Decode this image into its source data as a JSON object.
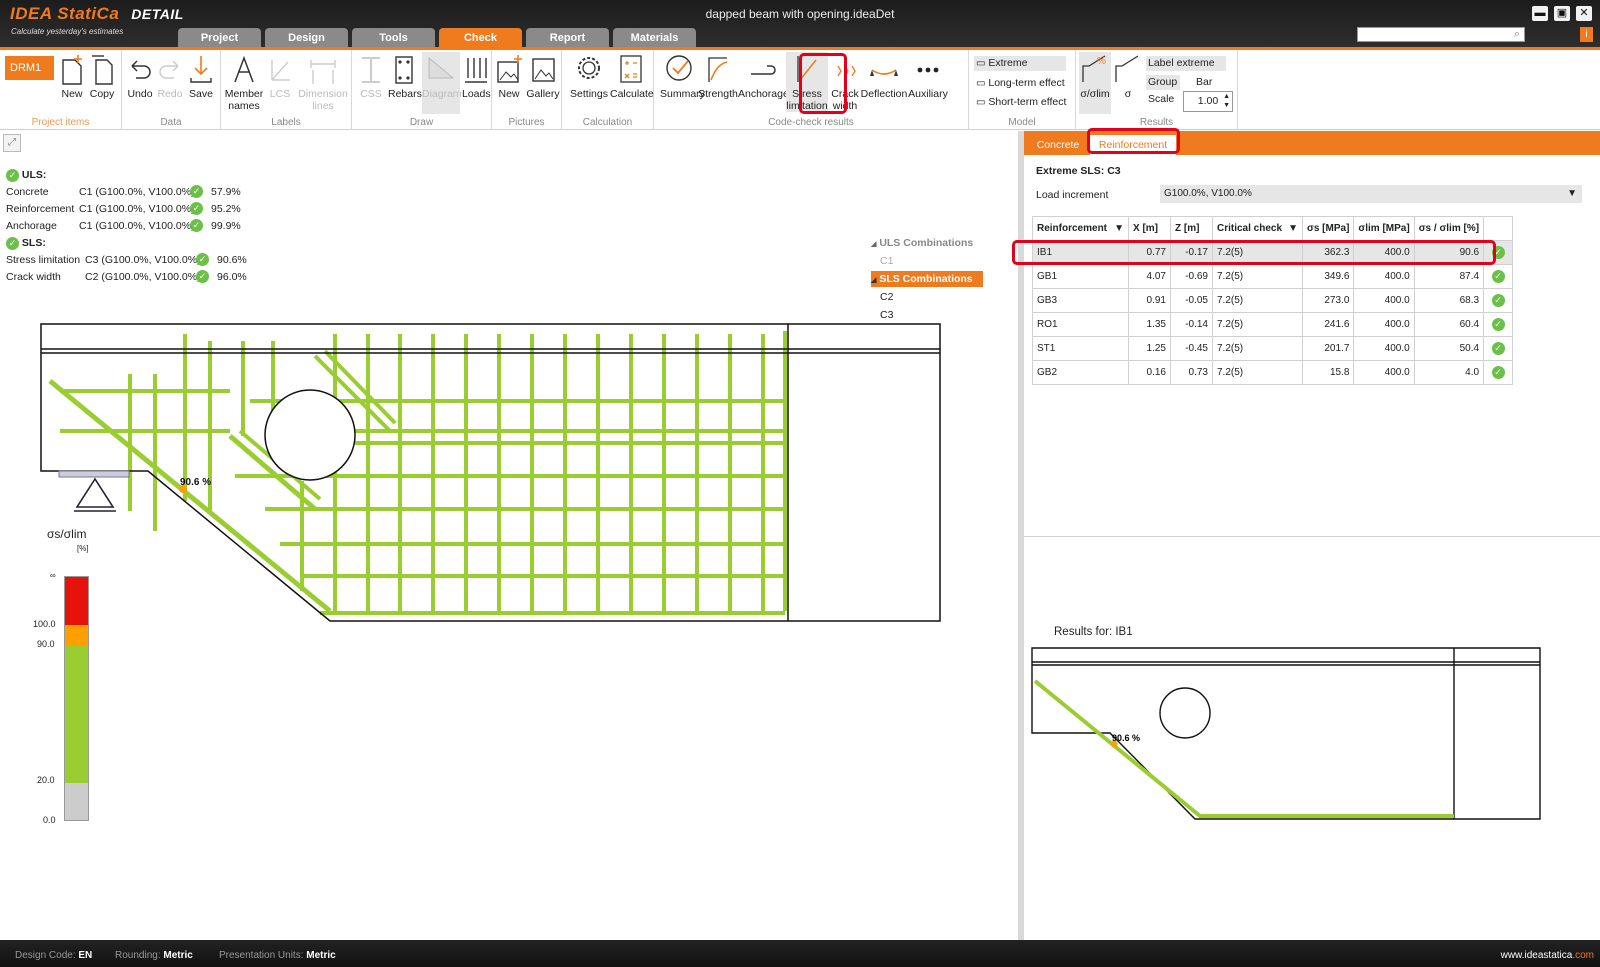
{
  "app": {
    "brand": "IDEA StatiCa",
    "product": "DETAIL",
    "slogan": "Calculate yesterday's estimates",
    "title": "dapped beam with opening.ideaDet"
  },
  "tabs": [
    "Project",
    "Design",
    "Tools",
    "Check",
    "Report",
    "Materials"
  ],
  "active_tab": "Check",
  "ribbon": {
    "project_items": {
      "model": "DRM1",
      "new": "New",
      "copy": "Copy",
      "label": "Project items"
    },
    "data": {
      "undo": "Undo",
      "redo": "Redo",
      "save": "Save",
      "label": "Data"
    },
    "labels": {
      "member": "Member\nnames",
      "lcs": "LCS",
      "dimension": "Dimension\nlines",
      "label": "Labels"
    },
    "draw": {
      "css": "CSS",
      "rebars": "Rebars",
      "diagram": "Diagram",
      "loads": "Loads",
      "label": "Draw"
    },
    "pictures": {
      "new": "New",
      "gallery": "Gallery",
      "label": "Pictures"
    },
    "calculation": {
      "settings": "Settings",
      "calculate": "Calculate",
      "label": "Calculation"
    },
    "code_check": {
      "summary": "Summary",
      "strength": "Strength",
      "anchorage": "Anchorage",
      "stress": "Stress\nlimitation",
      "crack": "Crack\nwidth",
      "deflection": "Deflection",
      "auxiliary": "Auxiliary",
      "label": "Code-check results"
    },
    "model": {
      "extreme": "Extreme",
      "long": "Long-term effect",
      "short": "Short-term effect",
      "label": "Model"
    },
    "results": {
      "ratio": "σ/σlim",
      "sigma": "σ",
      "label_extreme": "Label extreme",
      "group": "Group",
      "bar": "Bar",
      "scale_label": "Scale",
      "scale_value": "1.00",
      "label": "Results"
    }
  },
  "summary": {
    "uls_title": "ULS:",
    "sls_title": "SLS:",
    "uls": [
      {
        "name": "Concrete",
        "combo": "C1 (G100.0%, V100.0%)",
        "value": "57.9%"
      },
      {
        "name": "Reinforcement",
        "combo": "C1 (G100.0%, V100.0%)",
        "value": "95.2%"
      },
      {
        "name": "Anchorage",
        "combo": "C1 (G100.0%, V100.0%)",
        "value": "99.9%"
      }
    ],
    "sls": [
      {
        "name": "Stress limitation",
        "combo": "C3 (G100.0%, V100.0%)",
        "value": "90.6%"
      },
      {
        "name": "Crack width",
        "combo": "C2 (G100.0%, V100.0%)",
        "value": "96.0%"
      }
    ]
  },
  "combinations": {
    "uls_header": "ULS Combinations",
    "uls": [
      "C1"
    ],
    "sls_header": "SLS Combinations",
    "sls": [
      "C2",
      "C3"
    ]
  },
  "legend": {
    "title": "σs/σlim",
    "unit": "[%]",
    "ticks": [
      "∞",
      "100.0",
      "90.0",
      "20.0",
      "0.0"
    ],
    "colors": {
      "over": "#e8120c",
      "warn": "#ff9f00",
      "ok": "#9acd32",
      "low": "#cccccc"
    }
  },
  "model_label": "90.6 %",
  "right": {
    "tabs": [
      "Concrete",
      "Reinforcement"
    ],
    "active_tab": "Reinforcement",
    "extreme_title": "Extreme SLS: C3",
    "load_increment_label": "Load increment",
    "load_increment_value": "G100.0%, V100.0%",
    "table": {
      "headers": [
        "Reinforcement",
        "X [m]",
        "Z [m]",
        "Critical check",
        "σs [MPa]",
        "σlim [MPa]",
        "σs / σlim [%]"
      ],
      "rows": [
        [
          "IB1",
          "0.77",
          "-0.17",
          "7.2(5)",
          "362.3",
          "400.0",
          "90.6"
        ],
        [
          "GB1",
          "4.07",
          "-0.69",
          "7.2(5)",
          "349.6",
          "400.0",
          "87.4"
        ],
        [
          "GB3",
          "0.91",
          "-0.05",
          "7.2(5)",
          "273.0",
          "400.0",
          "68.3"
        ],
        [
          "RO1",
          "1.35",
          "-0.14",
          "7.2(5)",
          "241.6",
          "400.0",
          "60.4"
        ],
        [
          "ST1",
          "1.25",
          "-0.45",
          "7.2(5)",
          "201.7",
          "400.0",
          "50.4"
        ],
        [
          "GB2",
          "0.16",
          "0.73",
          "7.2(5)",
          "15.8",
          "400.0",
          "4.0"
        ]
      ]
    },
    "results_for": "Results for: IB1",
    "mini_label": "90.6 %"
  },
  "status": {
    "design_code_label": "Design Code:",
    "design_code": "EN",
    "rounding_label": "Rounding:",
    "rounding": "Metric",
    "units_label": "Presentation Units:",
    "units": "Metric",
    "web_a": "www.",
    "web_b": "ideastatica",
    "web_c": ".com"
  },
  "accent": "#f07a1e",
  "highlight": "#e3001b"
}
